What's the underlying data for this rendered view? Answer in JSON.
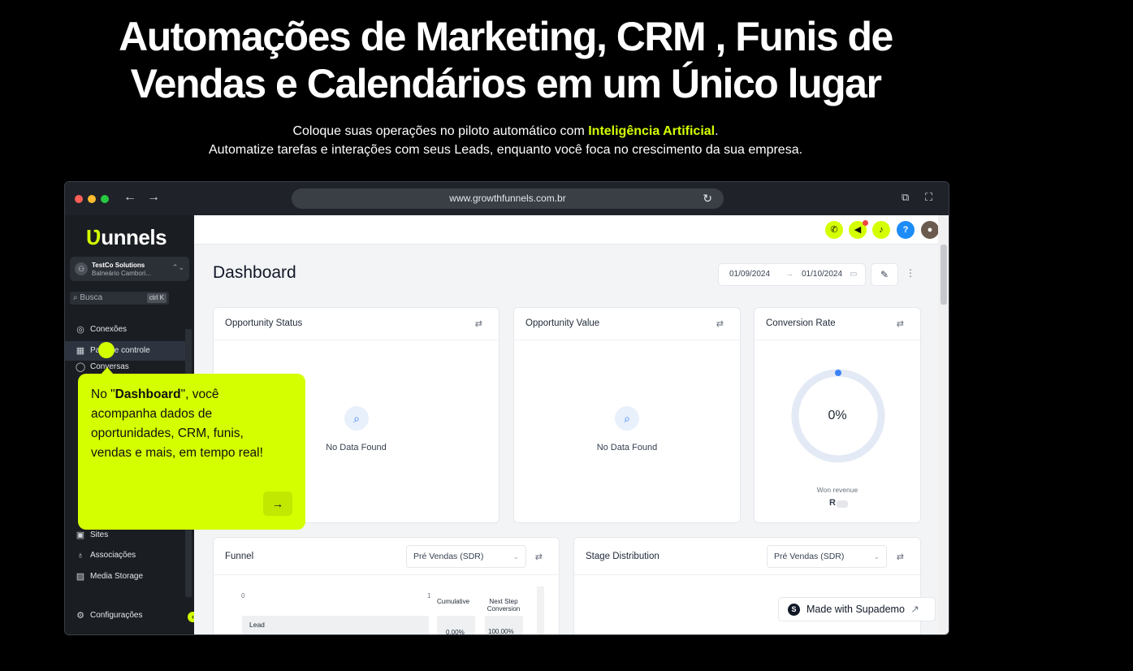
{
  "hero": {
    "title_line1": "Automações de Marketing, CRM , Funis de",
    "title_line2": "Vendas e Calendários em um Único lugar",
    "sub_line1_a": "Coloque suas operações no piloto automático com ",
    "sub_line1_highlight": "Inteligência Artificial",
    "sub_line1_b": ".",
    "sub_line2": "Automatize tarefas e interações com seus Leads, enquanto você foca no crescimento da sua empresa."
  },
  "browser": {
    "url": "www.growthfunnels.com.br"
  },
  "sidebar": {
    "logo_mark": "Ʋ",
    "logo_text": "unnels",
    "account_name": "TestCo Solutions",
    "account_location": "Balneário Cambori...",
    "search_placeholder": "Busca",
    "search_shortcut": "ctrl K",
    "items": [
      {
        "label": "Conexões",
        "icon": "connections-icon"
      },
      {
        "label": "de controle",
        "label_prefix": "Pa",
        "icon": "dashboard-icon"
      },
      {
        "label": "Conversas",
        "icon": "chat-icon"
      },
      {
        "label": "Sites",
        "icon": "sites-icon"
      },
      {
        "label": "Associações",
        "icon": "membership-icon"
      },
      {
        "label": "Media Storage",
        "icon": "media-icon"
      },
      {
        "label": "Configurações",
        "icon": "settings-icon"
      }
    ]
  },
  "app": {
    "page_title": "Dashboard",
    "date_from": "01/09/2024",
    "date_to": "01/10/2024",
    "cards": {
      "opportunity_status": {
        "title": "Opportunity Status",
        "empty": "No Data Found"
      },
      "opportunity_value": {
        "title": "Opportunity Value",
        "empty": "No Data Found"
      },
      "conversion_rate": {
        "title": "Conversion Rate",
        "value": "0%",
        "caption": "Won revenue",
        "currency": "R"
      },
      "funnel": {
        "title": "Funnel",
        "select": "Pré Vendas (SDR)",
        "axis_min": "0",
        "axis_max": "1",
        "col1": "Cumulative",
        "col2a": "Next Step",
        "col2b": "Conversion",
        "stage": "Lead",
        "cum_value": "0.00%",
        "conv_value": "100.00%"
      },
      "stage_distribution": {
        "title": "Stage Distribution",
        "select": "Pré Vendas (SDR)"
      }
    }
  },
  "tooltip": {
    "text_a": "No \"",
    "text_bold": "Dashboard",
    "text_b": "\", você acompanha dados de oportunidades, CRM, funis, vendas e mais, em tempo real!"
  },
  "badge": {
    "made_with": "Made with Supademo"
  },
  "colors": {
    "accent": "#d4ff00",
    "sidebar_bg": "#1a1d22",
    "primary_blue": "#3b82f6"
  }
}
